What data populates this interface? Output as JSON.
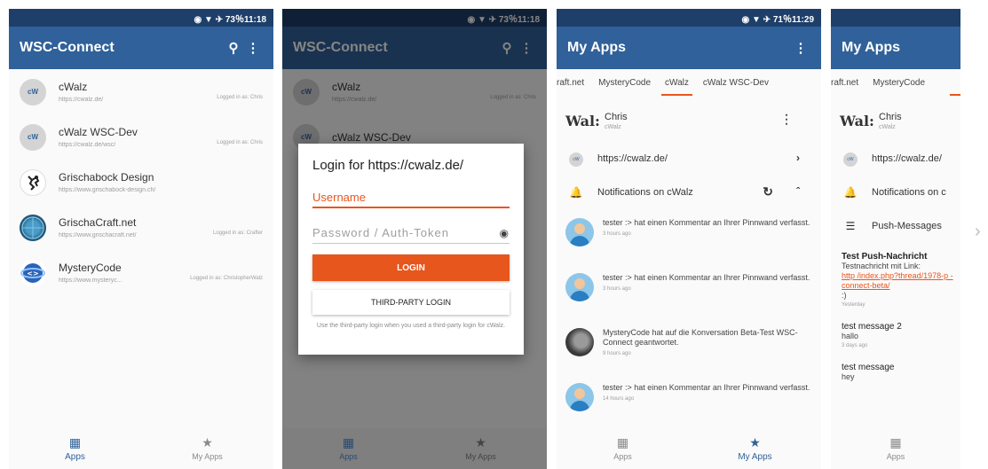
{
  "screens": {
    "s1": {
      "status": "◉ ▼ ✈ 73％11:18",
      "title": "WSC-Connect",
      "instances": [
        {
          "avatar": "cW",
          "name": "cWalz",
          "url": "https://cwalz.de/",
          "status": "Logged in as: Chris"
        },
        {
          "avatar": "cW",
          "name": "cWalz WSC-Dev",
          "url": "https://cwalz.de/wsc/",
          "status": "Logged in as: Chris"
        },
        {
          "avatar": "",
          "name": "Grischabock Design",
          "url": "https://www.grischabock-design.ch/",
          "status": ""
        },
        {
          "avatar": "",
          "name": "GrischaCraft.net",
          "url": "https://www.grischacraft.net/",
          "status": "Logged in as: Crafter"
        },
        {
          "avatar": "",
          "name": "MysteryCode",
          "url": "https://www.mysteryc...",
          "status": "Logged in as: ChristopherWalz"
        }
      ],
      "nav": {
        "apps": "Apps",
        "myapps": "My Apps"
      }
    },
    "s2": {
      "status": "◉ ▼ ✈ 73％11:18",
      "title": "WSC-Connect",
      "dialog": {
        "title": "Login for https://cwalz.de/",
        "username_placeholder": "Username",
        "password_placeholder": "Password / Auth-Token",
        "login": "LOGIN",
        "third_party": "THIRD-PARTY LOGIN",
        "hint": "Use the third-party login when you used a third-party login for cWalz."
      },
      "nav": {
        "apps": "Apps",
        "myapps": "My Apps"
      }
    },
    "s3": {
      "status": "◉ ▼ ✈ 71％11:29",
      "title": "My Apps",
      "tabs": [
        "raft.net",
        "MysteryCode",
        "cWalz",
        "cWalz WSC-Dev"
      ],
      "user": {
        "logo": "Wal:",
        "name": "Chris",
        "site": "cWalz"
      },
      "site_url": "https://cwalz.de/",
      "notifications_label": "Notifications on cWalz",
      "notifications": [
        {
          "text": "tester :> hat einen Kommentar an Ihrer Pinnwand verfasst.",
          "time": "3 hours ago"
        },
        {
          "text": "tester :> hat einen Kommentar an Ihrer Pinnwand verfasst.",
          "time": "3 hours ago"
        },
        {
          "text": "MysteryCode hat auf die Konversation Beta-Test WSC-Connect geantwortet.",
          "time": "9 hours ago"
        },
        {
          "text": "tester :> hat einen Kommentar an Ihrer Pinnwand verfasst.",
          "time": "14 hours ago"
        }
      ],
      "nav": {
        "apps": "Apps",
        "myapps": "My Apps"
      }
    },
    "s4": {
      "title": "My Apps",
      "tabs": [
        "raft.net",
        "MysteryCode"
      ],
      "user": {
        "logo": "Wal:",
        "name": "Chris",
        "site": "cWalz"
      },
      "site_url": "https://cwalz.de/",
      "notifications_label": "Notifications on c",
      "push_label": "Push-Messages",
      "push": [
        {
          "title": "Test Push-Nachricht",
          "body": "Testnachricht mit Link:",
          "link": "http /index.php?thread/1978-p -connect-beta/",
          "tail": ":)",
          "time": "Yesterday"
        },
        {
          "title": "test message 2",
          "body": "hallo",
          "time": "3 days ago"
        },
        {
          "title": "test message",
          "body": "hey",
          "time": ""
        }
      ],
      "nav": {
        "apps": "Apps"
      }
    }
  },
  "icons": {
    "search": "search-icon",
    "more": "more-vert-icon",
    "apps": "grid-icon",
    "myapps": "star-icon",
    "eye": "eye-icon",
    "bell": "bell-icon",
    "refresh": "refresh-icon",
    "collapse": "chevron-up-icon",
    "forward": "chevron-right-icon",
    "list": "list-icon"
  },
  "colors": {
    "primary": "#30619a",
    "status_bar": "#1d3f69",
    "accent": "#e7561c"
  }
}
